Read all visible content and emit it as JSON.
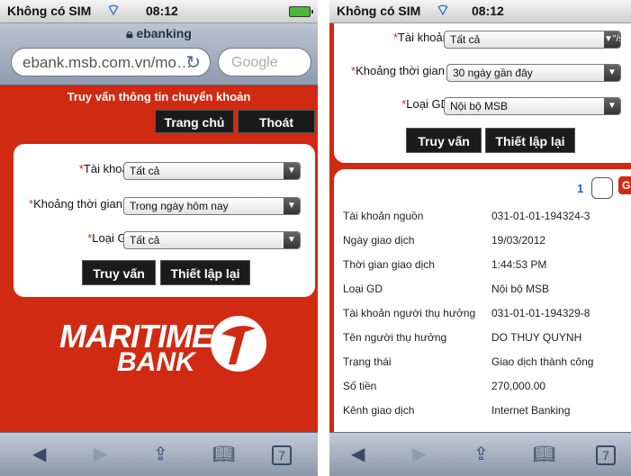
{
  "status": {
    "carrier": "Không có SIM",
    "time": "08:12"
  },
  "browser": {
    "site_title": "ebanking",
    "url": "ebank.msb.com.vn/mo…",
    "search_placeholder": "Google"
  },
  "page": {
    "headline": "Truy vấn thông tin chuyển khoản",
    "home_label": "Trang chủ",
    "logout_label": "Thoát",
    "brand_line1": "MARITIME",
    "brand_line2": "BANK"
  },
  "form_a": {
    "account_label": "Tài khoản",
    "account_value": "Tất cả",
    "period_label": "Khoảng thời gian",
    "period_value": "Trong ngày hôm nay",
    "type_label": "Loại GD",
    "type_value": "Tất cả",
    "query_label": "Truy vấn",
    "reset_label": "Thiết lập lại",
    "required_mark": "*"
  },
  "form_b": {
    "account_label": "Tài khoản",
    "account_value": "Tất cả",
    "period_label": "Khoảng thời gian",
    "period_value": "30 ngày gần đây",
    "type_label": "Loại GD",
    "type_value": "Nội bộ MSB",
    "query_label": "Truy vấn",
    "reset_label": "Thiết lập lại",
    "required_mark": "*"
  },
  "results": {
    "page_number": "1",
    "go_label": "Go",
    "rows": [
      {
        "label": "Tài khoản nguồn",
        "value": "031-01-01-194324-3"
      },
      {
        "label": "Ngày giao dịch",
        "value": "19/03/2012"
      },
      {
        "label": "Thời gian giao dịch",
        "value": "1:44:53 PM"
      },
      {
        "label": "Loại GD",
        "value": "Nội bộ MSB"
      },
      {
        "label": "Tài khoản người thụ hưởng",
        "value": "031-01-01-194329-8"
      },
      {
        "label": "Tên người thụ hưởng",
        "value": "DO THUY QUYNH"
      },
      {
        "label": "Trạng thái",
        "value": "Giao dịch thành công"
      },
      {
        "label": "Số tiền",
        "value": "270,000.00"
      },
      {
        "label": "Kênh giao dịch",
        "value": "Internet Banking"
      }
    ]
  },
  "toolbar": {
    "tabs_count": "7"
  },
  "colors": {
    "brand_red": "#d12a12",
    "dark_button": "#1b1b1b",
    "link_blue": "#1c63c9"
  }
}
